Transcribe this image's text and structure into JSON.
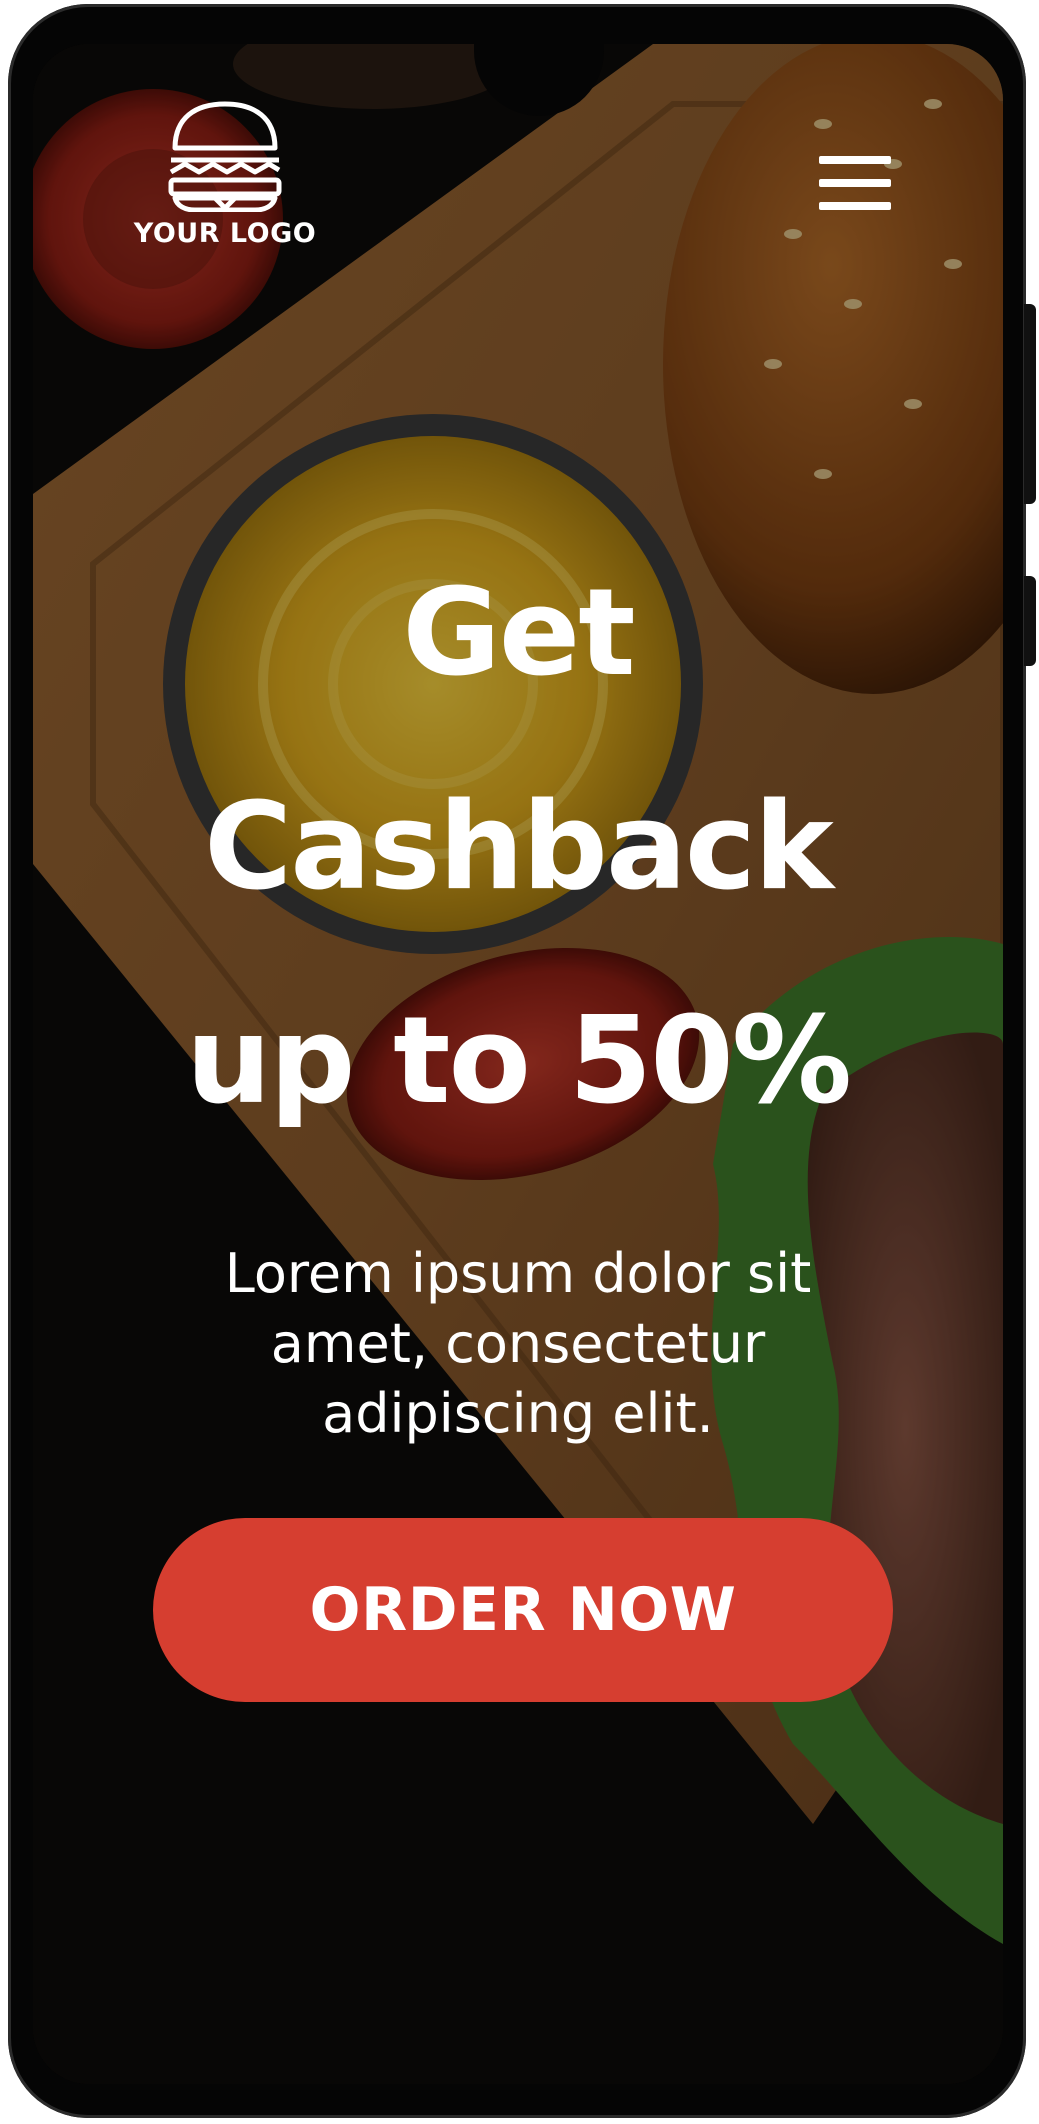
{
  "logo": {
    "text": "YOUR LOGO",
    "icon": "burger-icon"
  },
  "menu": {
    "icon": "hamburger-menu-icon"
  },
  "hero": {
    "line1": "Get",
    "line2": "Cashback",
    "line3": "up to 50%",
    "body_line1": "Lorem ipsum dolor sit",
    "body_line2": "amet, consectetur",
    "body_line3": "adipiscing elit.",
    "cta_label": "ORDER NOW"
  },
  "colors": {
    "accent": "#d63e30",
    "text": "#ffffff",
    "background": "#0d0b09",
    "board": "#8a5a2c",
    "sauce": "#e0b21f"
  }
}
